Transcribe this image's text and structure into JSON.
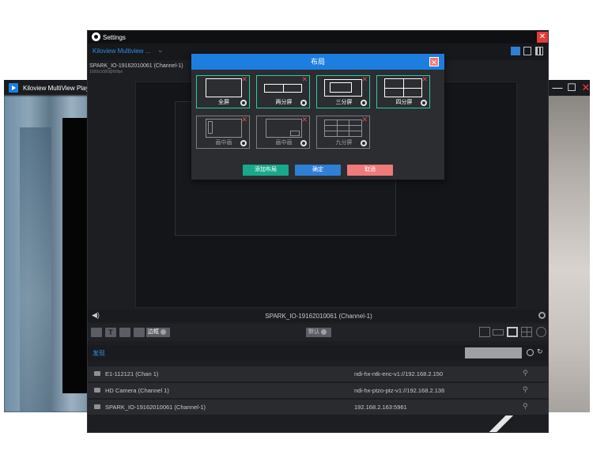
{
  "player_window": {
    "title": "Kiloview MultiView Player",
    "controls": {
      "minimize": "—",
      "maximize": "☐",
      "close": "✕"
    }
  },
  "settings": {
    "title": "Settings",
    "dropdown_value": "Kiloview Multiview ...",
    "header_icons": [
      "home-icon",
      "export-icon",
      "grid-icon"
    ],
    "source_title": "SPARK_IO-19162010061 (Channel-1)",
    "source_res": "1920x1080@60fps",
    "monitor_label": "SPARK_IO-19162010061 (Channel-1)",
    "border_button": "边框",
    "default_button": "默认",
    "found_label": "发现",
    "sources": [
      {
        "name": "E1-112121 (Chan 1)",
        "url": "ndi-hx-ntk-enc-v1://192.168.2.150"
      },
      {
        "name": "HD Camera (Channel 1)",
        "url": "ndi-hx-ptzo-ptz-v1://192.168.2.136"
      },
      {
        "name": "SPARK_IO-19162010061 (Channel-1)",
        "url": "192.168.2.163:5961"
      }
    ]
  },
  "layout_dialog": {
    "title": "布局",
    "tiles": [
      {
        "label": "全屏",
        "active": true,
        "kind": "single"
      },
      {
        "label": "两分屏",
        "active": true,
        "kind": "two"
      },
      {
        "label": "三分屏",
        "active": true,
        "kind": "three"
      },
      {
        "label": "四分屏",
        "active": true,
        "kind": "four"
      },
      {
        "label": "画中画",
        "active": false,
        "kind": "pip-left"
      },
      {
        "label": "画中画",
        "active": false,
        "kind": "pip-right"
      },
      {
        "label": "九分屏",
        "active": false,
        "kind": "nine"
      }
    ],
    "buttons": {
      "add": "添加布局",
      "confirm": "确定",
      "cancel": "取消"
    },
    "colors": {
      "add": "#1aa88a",
      "confirm": "#2f7fd6",
      "cancel": "#f07a7a",
      "active_border": "#2fc9a8"
    }
  }
}
